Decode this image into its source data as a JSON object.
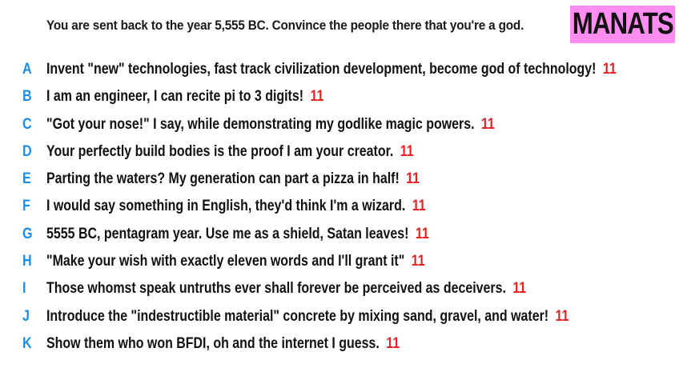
{
  "prompt": "You are sent back to the year 5,555 BC. Convince the people there that you're a god.",
  "logo_text": "MANATS",
  "colors": {
    "letter": "#1c8ee8",
    "score": "#e8201f",
    "logo_bg": "#ff8cf0"
  },
  "answers": [
    {
      "letter": "A",
      "text": "Invent \"new\" technologies, fast track civilization development, become god of technology!",
      "score": "11"
    },
    {
      "letter": "B",
      "text": "I am an engineer, I can recite pi to 3 digits!",
      "score": "11"
    },
    {
      "letter": "C",
      "text": "\"Got your nose!\" I say, while demonstrating my godlike magic powers.",
      "score": "11"
    },
    {
      "letter": "D",
      "text": "Your perfectly build bodies is the proof I am your creator.",
      "score": "11"
    },
    {
      "letter": "E",
      "text": "Parting the waters? My generation can part a pizza in half!",
      "score": "11"
    },
    {
      "letter": "F",
      "text": "I would say something in English, they'd think I'm a wizard.",
      "score": "11"
    },
    {
      "letter": "G",
      "text": "5555 BC, pentagram year. Use me as a shield, Satan leaves!",
      "score": "11"
    },
    {
      "letter": "H",
      "text": "\"Make your wish with exactly eleven words and I'll grant it\"",
      "score": "11"
    },
    {
      "letter": "I",
      "text": "Those whomst speak untruths ever shall forever be perceived as deceivers.",
      "score": "11"
    },
    {
      "letter": "J",
      "text": "Introduce the \"indestructible material\" concrete by mixing sand, gravel, and water!",
      "score": "11"
    },
    {
      "letter": "K",
      "text": "Show them who won BFDI, oh and the internet I guess.",
      "score": "11"
    }
  ]
}
